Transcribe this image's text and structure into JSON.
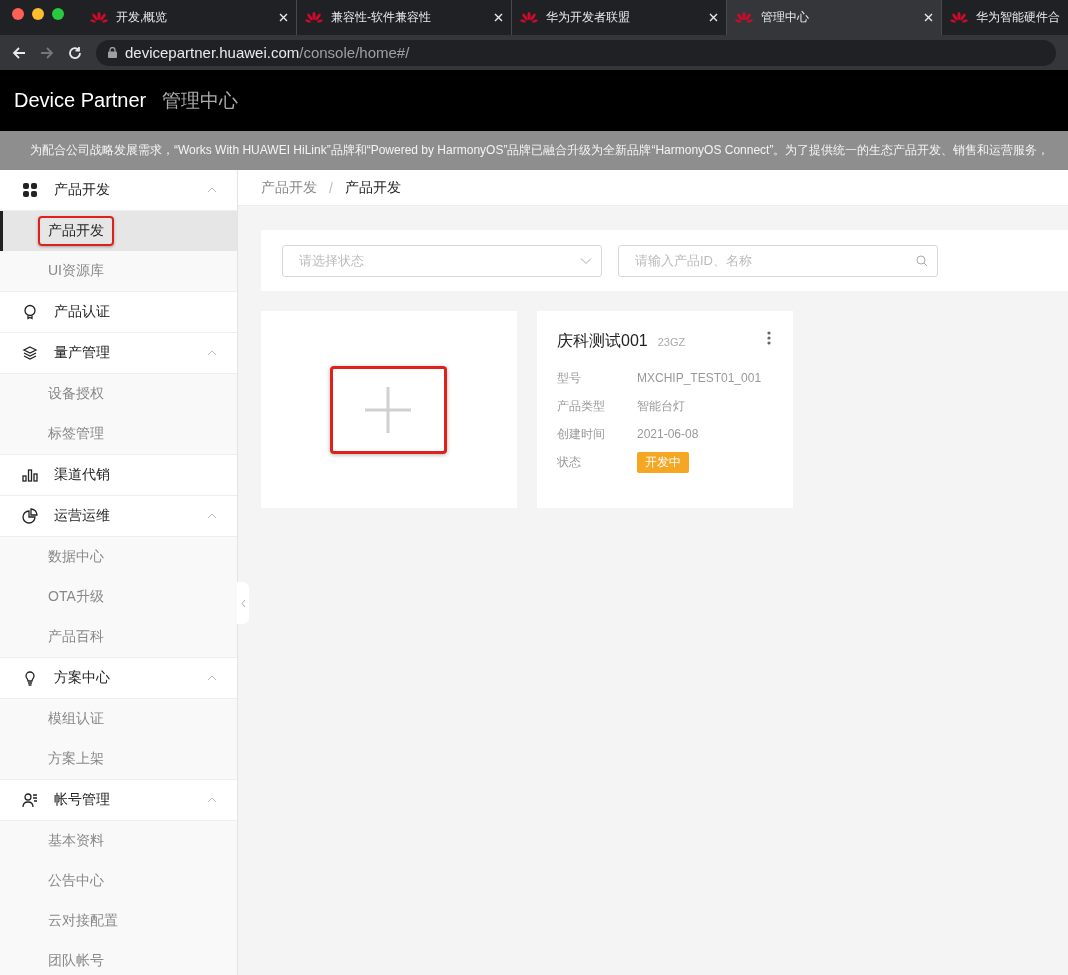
{
  "browser": {
    "tabs": [
      {
        "title": "开发,概览",
        "selected": false
      },
      {
        "title": "兼容性-软件兼容性",
        "selected": false
      },
      {
        "title": "华为开发者联盟",
        "selected": false
      },
      {
        "title": "管理中心",
        "selected": true
      },
      {
        "title": "华为智能硬件合",
        "selected": false
      }
    ],
    "url": {
      "host": "devicepartner.huawei.com",
      "path": "/console/home#/"
    }
  },
  "header": {
    "brand": "Device Partner",
    "title": "管理中心"
  },
  "notice": "为配合公司战略发展需求，“Works With HUAWEI HiLink”品牌和“Powered by HarmonyOS”品牌已融合升级为全新品牌“HarmonyOS Connect”。为了提供统一的生态产品开发、销售和运营服务，",
  "sidebar": {
    "groups": [
      {
        "label": "产品开发",
        "expanded": true,
        "children": [
          {
            "label": "产品开发",
            "selected": true,
            "highlighted": true
          },
          {
            "label": "UI资源库",
            "selected": false,
            "highlighted": false
          }
        ]
      },
      {
        "label": "产品认证",
        "expanded": false
      },
      {
        "label": "量产管理",
        "expanded": true,
        "children": [
          {
            "label": "设备授权",
            "selected": false,
            "highlighted": false
          },
          {
            "label": "标签管理",
            "selected": false,
            "highlighted": false
          }
        ]
      },
      {
        "label": "渠道代销",
        "expanded": false
      },
      {
        "label": "运营运维",
        "expanded": true,
        "children": [
          {
            "label": "数据中心",
            "selected": false,
            "highlighted": false
          },
          {
            "label": "OTA升级",
            "selected": false,
            "highlighted": false
          },
          {
            "label": "产品百科",
            "selected": false,
            "highlighted": false
          }
        ]
      },
      {
        "label": "方案中心",
        "expanded": true,
        "children": [
          {
            "label": "模组认证",
            "selected": false,
            "highlighted": false
          },
          {
            "label": "方案上架",
            "selected": false,
            "highlighted": false
          }
        ]
      },
      {
        "label": "帐号管理",
        "expanded": true,
        "children": [
          {
            "label": "基本资料",
            "selected": false,
            "highlighted": false
          },
          {
            "label": "公告中心",
            "selected": false,
            "highlighted": false
          },
          {
            "label": "云对接配置",
            "selected": false,
            "highlighted": false
          },
          {
            "label": "团队帐号",
            "selected": false,
            "highlighted": false
          }
        ]
      }
    ]
  },
  "breadcrumb": {
    "items": [
      "产品开发",
      "产品开发"
    ],
    "separators": [
      "/"
    ]
  },
  "filters": {
    "status": {
      "placeholder": "请选择状态"
    },
    "search": {
      "placeholder": "请输入产品ID、名称"
    }
  },
  "add_card": {
    "highlighted": true
  },
  "products": [
    {
      "name": "庆科测试001",
      "code": "23GZ",
      "fields": [
        {
          "label": "型号",
          "value": "MXCHIP_TEST01_001",
          "kind": "text"
        },
        {
          "label": "产品类型",
          "value": "智能台灯",
          "kind": "text"
        },
        {
          "label": "创建时间",
          "value": "2021-06-08",
          "kind": "text"
        },
        {
          "label": "状态",
          "value": "开发中",
          "kind": "tag"
        }
      ]
    }
  ]
}
